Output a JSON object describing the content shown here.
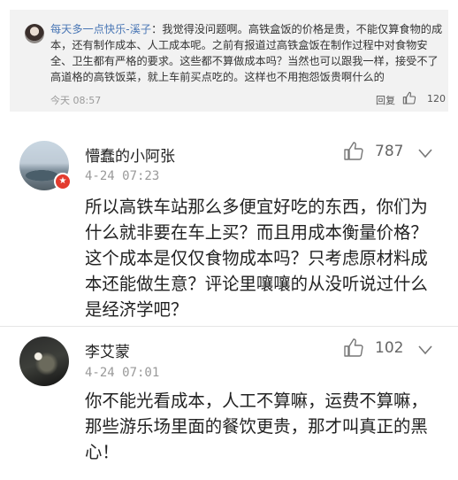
{
  "quoted": {
    "author": "每天多一点快乐-溪子",
    "text": "：我觉得没问题啊。高铁盒饭的价格是贵，不能仅算食物的成本，还有制作成本、人工成本呢。之前有报道过高铁盒饭在制作过程中对食物安全、卫生都有严格的要求。这些都不算做成本吗？当然也可以跟我一样，接受不了高道格的高铁饭菜，就上车前买点吃的。这样也不用抱怨饭贵啊什么的",
    "time": "今天 08:57",
    "reply_label": "回复",
    "likes": "120"
  },
  "comments": [
    {
      "author": "懵蠢的小阿张",
      "time": "4-24 07:23",
      "likes": "787",
      "badge": "★",
      "text": "所以高铁车站那么多便宜好吃的东西，你们为什么就非要在车上买？而且用成本衡量价格？这个成本是仅仅食物成本吗？只考虑原材料成本还能做生意？评论里嚷嚷的从没听说过什么是经济学吧？"
    },
    {
      "author": "李艾蒙",
      "time": "4-24 07:01",
      "likes": "102",
      "text": "你不能光看成本，人工不算嘛，运费不算嘛，那些游乐场里面的餐饮更贵，那才叫真正的黑心！"
    }
  ],
  "icons": {
    "like": "thumbs-up-icon",
    "menu": "chevron-down-icon"
  },
  "colors": {
    "quote_bg": "#f2f2f2",
    "author_link": "#4a77b5",
    "badge": "#e33b2e"
  }
}
